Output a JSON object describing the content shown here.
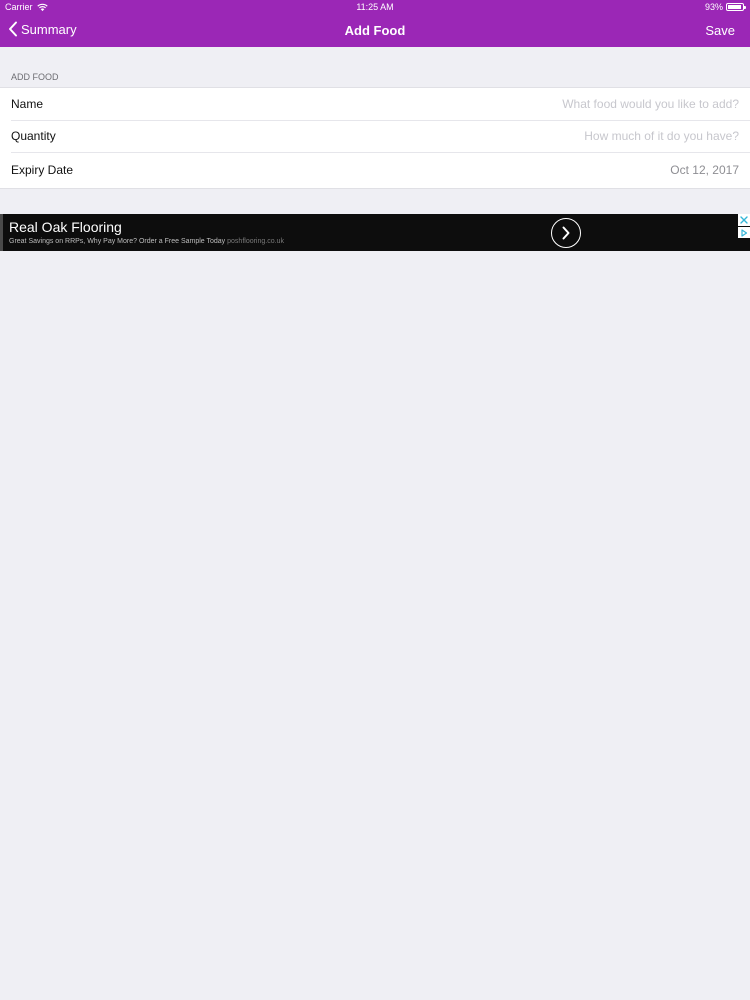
{
  "status_bar": {
    "carrier": "Carrier",
    "time": "11:25 AM",
    "battery_text": "93%",
    "battery_level": 0.93
  },
  "nav": {
    "back_label": "Summary",
    "title": "Add Food",
    "save_label": "Save"
  },
  "form": {
    "section_header": "ADD FOOD",
    "name": {
      "label": "Name",
      "value": "",
      "placeholder": "What food would you like to add?"
    },
    "quantity": {
      "label": "Quantity",
      "value": "",
      "placeholder": "How much of it do you have?"
    },
    "expiry_date": {
      "label": "Expiry Date",
      "value": "Oct 12, 2017"
    }
  },
  "ad": {
    "title": "Real Oak Flooring",
    "subtitle": "Great Savings on RRPs, Why Pay More? Order a Free Sample Today",
    "domain": "poshflooring.co.uk"
  },
  "colors": {
    "accent": "#9b27b6",
    "background": "#efeff4",
    "ad_background": "#0d0d0d",
    "ad_choices": "#35b6d8"
  },
  "icons": {
    "back": "chevron-left-icon",
    "wifi": "wifi-icon",
    "battery": "battery-icon",
    "ad_arrow": "chevron-right-icon",
    "ad_close": "close-icon",
    "ad_info": "ad-choices-icon"
  }
}
